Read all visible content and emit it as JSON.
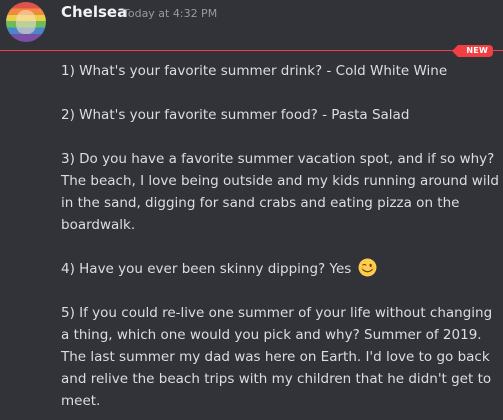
{
  "message": {
    "author": "Chelsea",
    "timestamp": "Today at 4:32 PM",
    "new_badge": "NEW",
    "avatar_icon": "rainbow-profile-avatar",
    "paragraphs": [
      "1) What's your favorite summer drink? - Cold White Wine",
      "2) What's your favorite summer food? - Pasta Salad",
      "3) Do you have a favorite summer vacation spot, and if so why? The beach, I love being outside and my kids running around wild in the sand, digging for sand crabs and eating pizza on the boardwalk.",
      "4) Have you ever been skinny dipping? Yes",
      "5) If you could re-live one summer of your life without changing a thing, which one would you pick and why? Summer of 2019. The last summer my dad was here on Earth. I'd love to go back and relive the beach trips with my children that he didn't get to meet."
    ],
    "emoji": "winking-face-emoji"
  },
  "colors": {
    "background": "#313338",
    "text": "#dbdee1",
    "username": "#f2f3f5",
    "timestamp": "#949ba4",
    "new_red": "#f23f43"
  }
}
